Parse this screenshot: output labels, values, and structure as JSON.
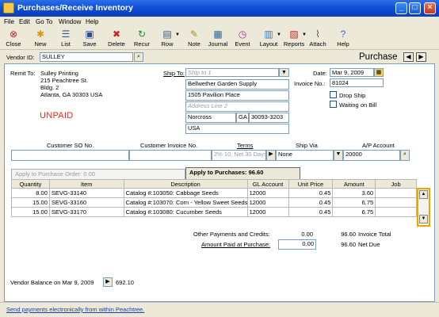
{
  "window": {
    "title": "Purchases/Receive Inventory"
  },
  "menu": [
    "File",
    "Edit",
    "Go To",
    "Window",
    "Help"
  ],
  "toolbar": [
    "Close",
    "New",
    "List",
    "Save",
    "Delete",
    "Recur",
    "Row",
    "Note",
    "Journal",
    "Event",
    "Layout",
    "Reports",
    "Attach",
    "Help"
  ],
  "header": {
    "vendor_id_label": "Vendor ID:",
    "vendor_id": "SULLEY",
    "form_title": "Purchase"
  },
  "remit": {
    "label": "Remit To:",
    "lines": [
      "Sulley Printing",
      "215 Peachtree St.",
      "Bldg. 2",
      "Atlanta, GA 30303 USA"
    ]
  },
  "status": "UNPAID",
  "ship_to": {
    "label": "Ship To:",
    "select_placeholder": "Ship to 1",
    "name": "Bellwether Garden Supply",
    "address1": "1505 Pavilion Place",
    "address2_placeholder": "Address Line 2",
    "city": "Norcross",
    "state": "GA",
    "zip": "30093-3203",
    "country": "USA"
  },
  "date": {
    "label": "Date:",
    "value": "Mar 9, 2009"
  },
  "invoice_no": {
    "label": "Invoice No.:",
    "value": "81024"
  },
  "options": {
    "drop_ship": "Drop Ship",
    "waiting_on_bill": "Waiting on Bill"
  },
  "info_row": {
    "labels": [
      "Customer SO No.",
      "Customer Invoice No.",
      "Terms",
      "Ship Via",
      "A/P Account"
    ],
    "customer_so": "",
    "customer_invoice": "",
    "terms": "2% 10, Net 30 Days",
    "ship_via": "None",
    "ap_account": "20000"
  },
  "tabs": {
    "apply_to_po": "Apply to Purchase Order: 0.00",
    "apply_to_purchases": "Apply to Purchases: 96.60"
  },
  "columns": [
    "Quantity",
    "Item",
    "Description",
    "GL Account",
    "Unit Price",
    "Amount",
    "Job"
  ],
  "rows": [
    {
      "qty": "8.00",
      "item": "SEVG-33140",
      "desc": "Catalog #:103050: Cabbage Seeds",
      "gl": "12000",
      "price": "0.45",
      "amount": "3.60",
      "job": ""
    },
    {
      "qty": "15.00",
      "item": "SEVG-33160",
      "desc": "Catalog #:103070: Corn - Yellow Sweet Seeds",
      "gl": "12000",
      "price": "0.45",
      "amount": "6.75",
      "job": ""
    },
    {
      "qty": "15.00",
      "item": "SEVG-33170",
      "desc": "Catalog #:103080: Cucumber Seeds",
      "gl": "12000",
      "price": "0.45",
      "amount": "6.75",
      "job": ""
    }
  ],
  "totals": {
    "other_label": "Other Payments and Credits:",
    "other_value": "0.00",
    "invoice_total": "96.60",
    "invoice_total_label": "Invoice Total",
    "amount_paid_label": "Amount Paid at Purchase:",
    "amount_paid": "0.00",
    "net_due": "96.60",
    "net_due_label": "Net Due"
  },
  "vendor_balance": {
    "label": "Vendor Balance on Mar 9, 2009",
    "value": "692.10"
  },
  "footer_link": "Send payments electronically from within Peachtree.",
  "colors": {
    "title_bar": "#0a49d0",
    "status_unpaid": "#e8261a",
    "highlight": "#e8a800",
    "link": "#1a3ea8"
  }
}
